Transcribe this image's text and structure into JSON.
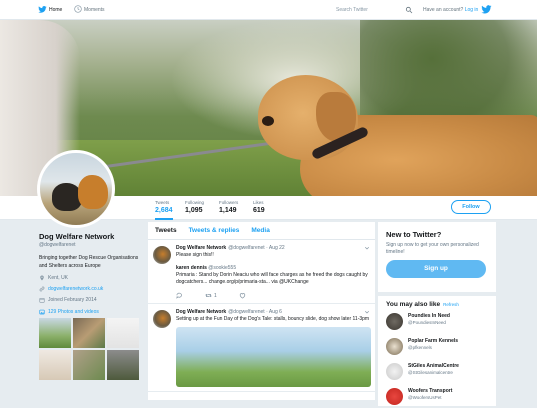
{
  "topbar": {
    "home": "Home",
    "moments": "Moments",
    "search_placeholder": "Search Twitter",
    "login_prompt": "Have an account?",
    "login_link": "Log in"
  },
  "profile": {
    "name": "Dog Welfare Network",
    "handle": "@dogwelfarenet",
    "bio": "Bringing together Dog Rescue Organisations and Shelters across Europe",
    "location": "Kent, UK",
    "website": "dogwelfarenetwork.co.uk",
    "joined": "Joined February 2014",
    "photos_label": "129 Photos and videos"
  },
  "stats": [
    {
      "label": "Tweets",
      "value": "2,684"
    },
    {
      "label": "Following",
      "value": "1,095"
    },
    {
      "label": "Followers",
      "value": "1,149"
    },
    {
      "label": "Likes",
      "value": "619"
    }
  ],
  "follow_label": "Follow",
  "tabs": [
    "Tweets",
    "Tweets & replies",
    "Media"
  ],
  "tweets": [
    {
      "name": "Dog Welfare Network",
      "meta": "@dogwelfarenet · Aug 22",
      "text": "Please sign this!!",
      "quote_name": "karen dennis",
      "quote_handle": "@sookie555",
      "quote_text": "Primaria : Stand by Dorin Neaciu who will face charges as he freed the dogs caught by dogcatchers... change.org/p/primaria-sta... via @UKChange",
      "reply_count": "",
      "retweet_count": "1",
      "like_count": ""
    },
    {
      "name": "Dog Welfare Network",
      "meta": "@dogwelfarenet · Aug 6",
      "text": "Setting up at the Fun Day of the Dog's Tale: stalls, bouncy slide, dog show later 11-3pm"
    }
  ],
  "newbox": {
    "title": "New to Twitter?",
    "desc": "Sign up now to get your own personalized timeline!",
    "signup": "Sign up"
  },
  "suggestions": {
    "title": "You may also like",
    "refresh": "Refresh",
    "items": [
      {
        "name": "Poundies In Need",
        "handle": "@PoundiesInNeed"
      },
      {
        "name": "Poplar Farm Kennels",
        "handle": "@pfkennels"
      },
      {
        "name": "StGiles AnimalCentre",
        "handle": "@StGilesanimalcentre"
      },
      {
        "name": "Woofers Transport",
        "handle": "@WoofersUsPet"
      }
    ]
  },
  "colors": {
    "accent": "#1da1f2",
    "background": "#e6ecf0"
  }
}
